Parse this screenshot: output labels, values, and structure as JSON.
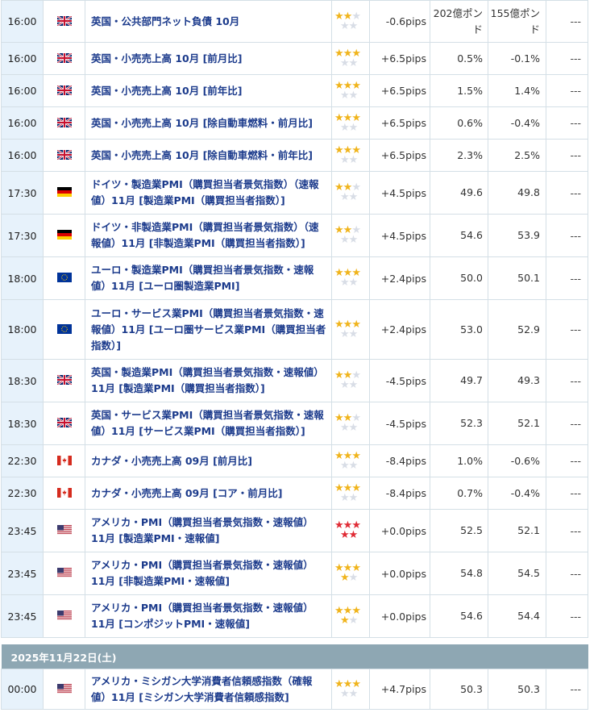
{
  "colors": {
    "gold_star": "#f0b41c",
    "red_star": "#e02b35",
    "empty_star": "#d8dde6",
    "time_bg": "#e7f2fb",
    "indicator_text": "#1c3b8c",
    "date_bar": "#8ea7b3"
  },
  "rows1": [
    {
      "time": "16:00",
      "country": "uk",
      "indicator": "英国・公共部門ネット負債 10月",
      "stars": 2,
      "star_color": "gold",
      "pips": "-0.6pips",
      "prev": "202億ポンド",
      "forecast": "155億ポンド",
      "result": "---"
    },
    {
      "time": "16:00",
      "country": "uk",
      "indicator": "英国・小売売上高 10月 [前月比]",
      "stars": 3,
      "star_color": "gold",
      "pips": "+6.5pips",
      "prev": "0.5%",
      "forecast": "-0.1%",
      "result": "---"
    },
    {
      "time": "16:00",
      "country": "uk",
      "indicator": "英国・小売売上高 10月 [前年比]",
      "stars": 3,
      "star_color": "gold",
      "pips": "+6.5pips",
      "prev": "1.5%",
      "forecast": "1.4%",
      "result": "---"
    },
    {
      "time": "16:00",
      "country": "uk",
      "indicator": "英国・小売売上高 10月 [除自動車燃料・前月比]",
      "stars": 3,
      "star_color": "gold",
      "pips": "+6.5pips",
      "prev": "0.6%",
      "forecast": "-0.4%",
      "result": "---"
    },
    {
      "time": "16:00",
      "country": "uk",
      "indicator": "英国・小売売上高 10月 [除自動車燃料・前年比]",
      "stars": 3,
      "star_color": "gold",
      "pips": "+6.5pips",
      "prev": "2.3%",
      "forecast": "2.5%",
      "result": "---"
    },
    {
      "time": "17:30",
      "country": "de",
      "indicator": "ドイツ・製造業PMI（購買担当者景気指数）（速報値）11月 [製造業PMI（購買担当者指数）]",
      "stars": 2,
      "star_color": "gold",
      "pips": "+4.5pips",
      "prev": "49.6",
      "forecast": "49.8",
      "result": "---"
    },
    {
      "time": "17:30",
      "country": "de",
      "indicator": "ドイツ・非製造業PMI（購買担当者景気指数）（速報値）11月 [非製造業PMI（購買担当者指数）]",
      "stars": 2,
      "star_color": "gold",
      "pips": "+4.5pips",
      "prev": "54.6",
      "forecast": "53.9",
      "result": "---"
    },
    {
      "time": "18:00",
      "country": "eu",
      "indicator": "ユーロ・製造業PMI（購買担当者景気指数・速報値）11月 [ユーロ圏製造業PMI]",
      "stars": 3,
      "star_color": "gold",
      "pips": "+2.4pips",
      "prev": "50.0",
      "forecast": "50.1",
      "result": "---"
    },
    {
      "time": "18:00",
      "country": "eu",
      "indicator": "ユーロ・サービス業PMI（購買担当者景気指数・速報値）11月 [ユーロ圏サービス業PMI（購買担当者指数）]",
      "stars": 3,
      "star_color": "gold",
      "pips": "+2.4pips",
      "prev": "53.0",
      "forecast": "52.9",
      "result": "---"
    },
    {
      "time": "18:30",
      "country": "uk",
      "indicator": "英国・製造業PMI（購買担当者景気指数・速報値）11月 [製造業PMI（購買担当者指数）]",
      "stars": 2,
      "star_color": "gold",
      "pips": "-4.5pips",
      "prev": "49.7",
      "forecast": "49.3",
      "result": "---"
    },
    {
      "time": "18:30",
      "country": "uk",
      "indicator": "英国・サービス業PMI（購買担当者景気指数・速報値）11月 [サービス業PMI（購買担当者指数）]",
      "stars": 2,
      "star_color": "gold",
      "pips": "-4.5pips",
      "prev": "52.3",
      "forecast": "52.1",
      "result": "---"
    },
    {
      "time": "22:30",
      "country": "ca",
      "indicator": "カナダ・小売売上高 09月 [前月比]",
      "stars": 3,
      "star_color": "gold",
      "pips": "-8.4pips",
      "prev": "1.0%",
      "forecast": "-0.6%",
      "result": "---"
    },
    {
      "time": "22:30",
      "country": "ca",
      "indicator": "カナダ・小売売上高 09月 [コア・前月比]",
      "stars": 3,
      "star_color": "gold",
      "pips": "-8.4pips",
      "prev": "0.7%",
      "forecast": "-0.4%",
      "result": "---"
    },
    {
      "time": "23:45",
      "country": "us",
      "indicator": "アメリカ・PMI（購買担当者景気指数・速報値）11月 [製造業PMI・速報値]",
      "stars": 5,
      "star_color": "red",
      "pips": "+0.0pips",
      "prev": "52.5",
      "forecast": "52.1",
      "result": "---"
    },
    {
      "time": "23:45",
      "country": "us",
      "indicator": "アメリカ・PMI（購買担当者景気指数・速報値）11月 [非製造業PMI・速報値]",
      "stars": 4,
      "star_color": "gold",
      "pips": "+0.0pips",
      "prev": "54.8",
      "forecast": "54.5",
      "result": "---"
    },
    {
      "time": "23:45",
      "country": "us",
      "indicator": "アメリカ・PMI（購買担当者景気指数・速報値）11月 [コンポジットPMI・速報値]",
      "stars": 4,
      "star_color": "gold",
      "pips": "+0.0pips",
      "prev": "54.6",
      "forecast": "54.4",
      "result": "---"
    }
  ],
  "date_header": "2025年11月22日(土)",
  "rows2": [
    {
      "time": "00:00",
      "country": "us",
      "indicator": "アメリカ・ミシガン大学消費者信頼感指数（確報値）11月 [ミシガン大学消費者信頼感指数]",
      "stars": 3,
      "star_color": "gold",
      "pips": "+4.7pips",
      "prev": "50.3",
      "forecast": "50.3",
      "result": "---"
    }
  ]
}
